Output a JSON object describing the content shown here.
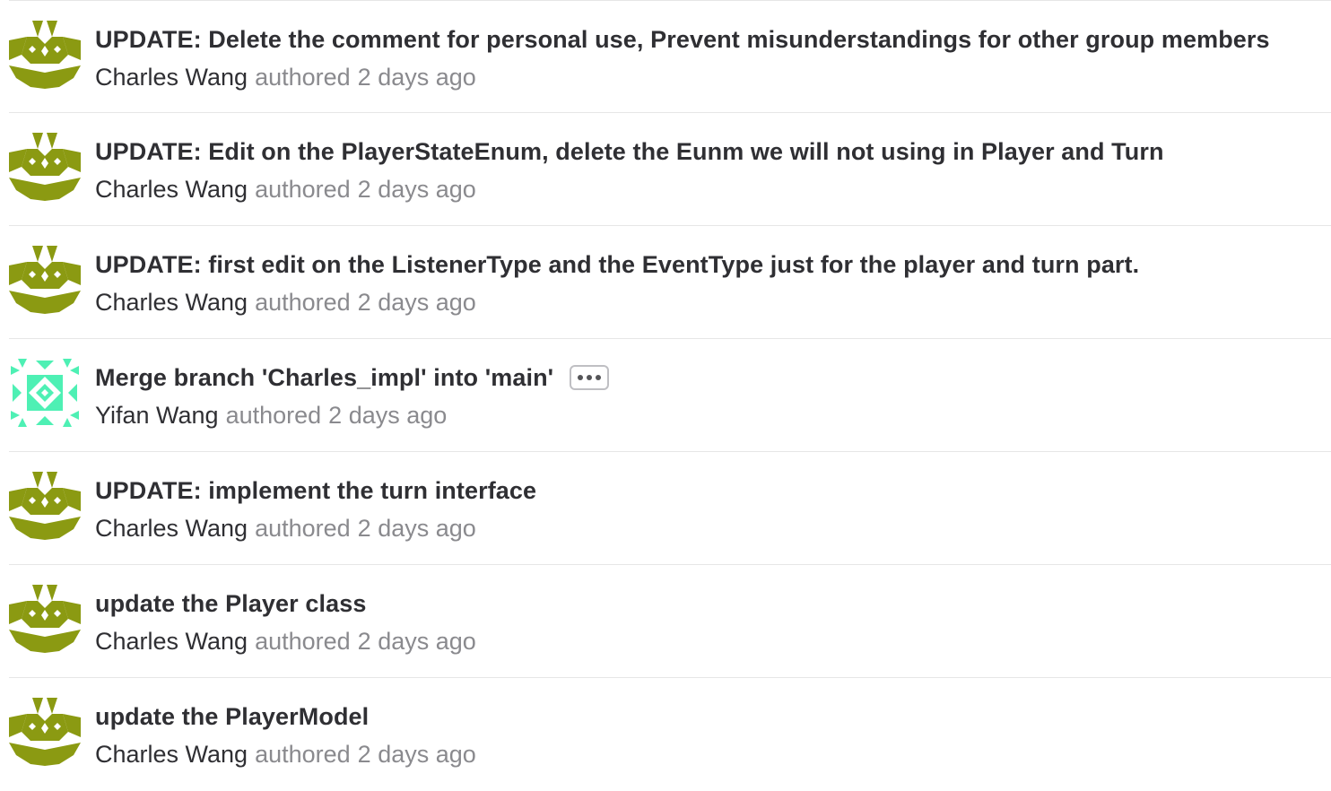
{
  "commits": [
    {
      "title": "UPDATE: Delete the comment for personal use, Prevent misunderstandings for other group members",
      "author": "Charles Wang",
      "authored_label": "authored",
      "time": "2 days ago",
      "avatar": "charles-avatar"
    },
    {
      "title": "UPDATE: Edit on the PlayerStateEnum, delete the Eunm we will not using in Player and Turn",
      "author": "Charles Wang",
      "authored_label": "authored",
      "time": "2 days ago",
      "avatar": "charles-avatar"
    },
    {
      "title": "UPDATE: first edit on the ListenerType and the EventType just for the player and turn part.",
      "author": "Charles Wang",
      "authored_label": "authored",
      "time": "2 days ago",
      "avatar": "charles-avatar"
    },
    {
      "title": "Merge branch 'Charles_impl' into 'main'",
      "author": "Yifan Wang",
      "authored_label": "authored",
      "time": "2 days ago",
      "avatar": "yifan-avatar",
      "has_more_button": true
    },
    {
      "title": "UPDATE: implement the turn interface",
      "author": "Charles Wang",
      "authored_label": "authored",
      "time": "2 days ago",
      "avatar": "charles-avatar"
    },
    {
      "title": "update the Player class",
      "author": "Charles Wang",
      "authored_label": "authored",
      "time": "2 days ago",
      "avatar": "charles-avatar"
    },
    {
      "title": "update the PlayerModel",
      "author": "Charles Wang",
      "authored_label": "authored",
      "time": "2 days ago",
      "avatar": "charles-avatar"
    }
  ],
  "colors": {
    "charles_avatar": "#8b9a12",
    "yifan_avatar": "#4ef0b4",
    "title_text": "#2f2f33",
    "muted_text": "#8a8a8e",
    "divider": "#e6e6e6"
  }
}
